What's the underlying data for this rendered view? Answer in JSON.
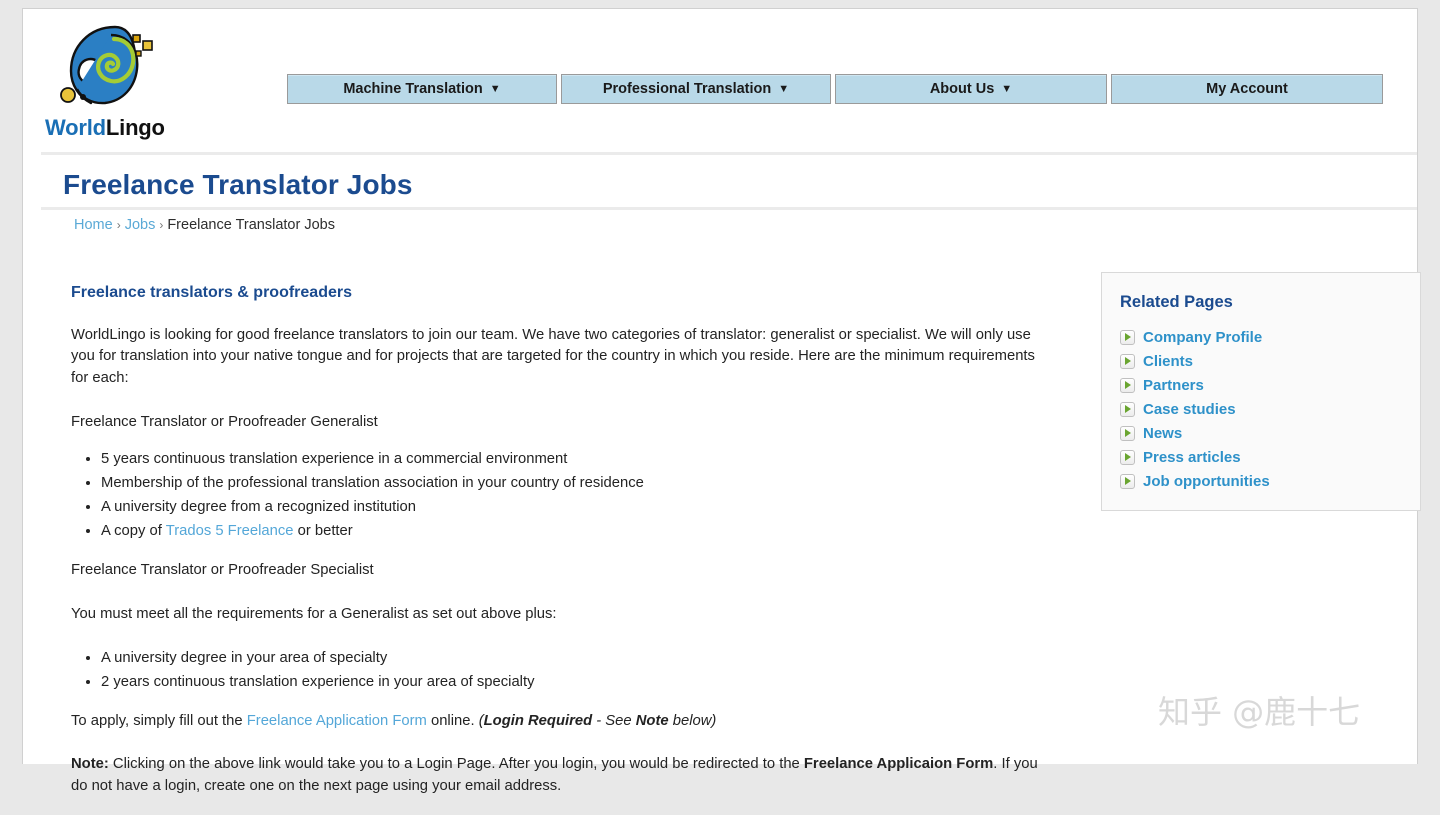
{
  "site": {
    "logo_word_primary": "World",
    "logo_word_secondary": "Lingo",
    "logo_icon": "worldlingo-head-spiral-logo"
  },
  "nav": {
    "items": [
      {
        "label": "Machine Translation",
        "caret": "▼",
        "has_dropdown": true
      },
      {
        "label": "Professional Translation",
        "caret": "▼",
        "has_dropdown": true
      },
      {
        "label": "About Us",
        "caret": "▼",
        "has_dropdown": true
      },
      {
        "label": "My Account",
        "caret": "",
        "has_dropdown": false
      }
    ],
    "background": "#b9d9e8",
    "border": "#9a9a9a"
  },
  "page": {
    "title": "Freelance Translator Jobs",
    "title_color": "#1b4b8f"
  },
  "breadcrumb": {
    "home": "Home",
    "sep1": "›",
    "jobs": "Jobs",
    "sep2": "›",
    "current": "Freelance Translator Jobs",
    "link_color": "#5aa9d6"
  },
  "main": {
    "heading": "Freelance translators & proofreaders",
    "intro": "WorldLingo is looking for good freelance translators to join our team. We have two categories of translator: generalist or specialist. We will only use you for translation into your native tongue and for projects that are targeted for the country in which you reside. Here are the minimum requirements for each:",
    "generalist_heading": "Freelance Translator or Proofreader Generalist",
    "generalist_items": [
      "5 years continuous translation experience in a commercial environment",
      "Membership of the professional translation association in your country of residence",
      "A university degree from a recognized institution"
    ],
    "generalist_last_prefix": "A copy of ",
    "generalist_last_link": "Trados 5 Freelance",
    "generalist_last_suffix": " or better",
    "specialist_heading": "Freelance Translator or Proofreader Specialist",
    "specialist_intro": "You must meet all the requirements for a Generalist as set out above plus:",
    "specialist_items": [
      "A university degree in your area of specialty",
      "2 years continuous translation experience in your area of specialty"
    ],
    "apply_prefix": "To apply, simply fill out the ",
    "apply_link": "Freelance Application Form",
    "apply_mid": " online. ",
    "apply_paren_open": "(",
    "apply_login_required": "Login Required",
    "apply_dash": " - ",
    "apply_see": "See ",
    "apply_note_word": "Note",
    "apply_below": " below",
    "apply_paren_close": ")",
    "note_label": "Note:",
    "note_text_1": " Clicking on the above link would take you to a Login Page. After you login, you would be redirected to the ",
    "note_bold_form": "Freelance Applicaion Form",
    "note_text_2": ". If you do not have a login, create one on the next page using your email address.",
    "link_color": "#54a7d8"
  },
  "sidebar": {
    "title": "Related Pages",
    "items": [
      {
        "label": "Company Profile",
        "icon": "green-arrow-icon"
      },
      {
        "label": "Clients",
        "icon": "green-arrow-icon"
      },
      {
        "label": "Partners",
        "icon": "green-arrow-icon"
      },
      {
        "label": "Case studies",
        "icon": "green-arrow-icon"
      },
      {
        "label": "News",
        "icon": "green-arrow-icon"
      },
      {
        "label": "Press articles",
        "icon": "green-arrow-icon"
      },
      {
        "label": "Job opportunities",
        "icon": "green-arrow-icon"
      }
    ],
    "link_color": "#2e91c9",
    "title_color": "#1b4b8f"
  },
  "watermark": {
    "text": "知乎 @鹿十七"
  }
}
